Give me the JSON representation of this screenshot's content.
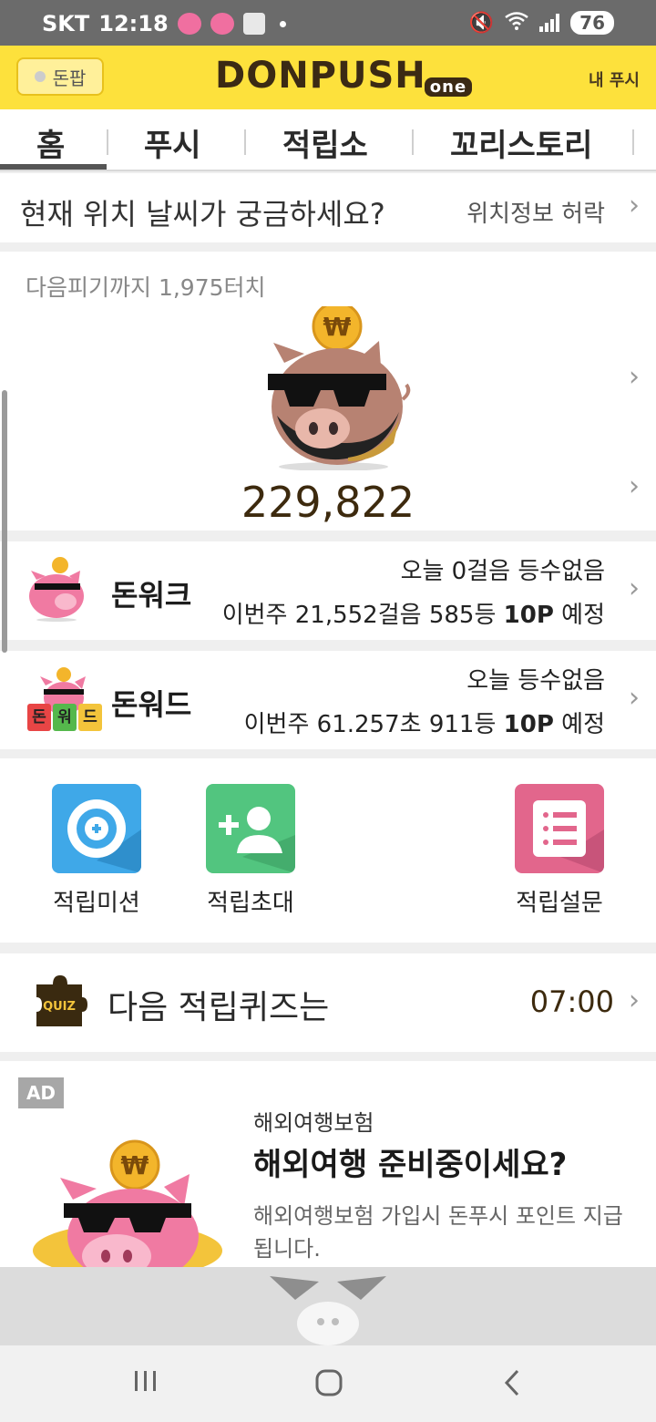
{
  "status": {
    "carrier": "SKT",
    "time": "12:18",
    "battery": "76"
  },
  "appbar": {
    "donpan_label": "돈팝",
    "logo": "DONPUSH",
    "logo_suffix": "one",
    "my_push": "내 푸시"
  },
  "tabs": [
    {
      "label": "홈"
    },
    {
      "label": "푸시"
    },
    {
      "label": "적립소"
    },
    {
      "label": "꼬리스토리"
    }
  ],
  "location": {
    "question": "현재 위치 날씨가 궁금하세요?",
    "permission": "위치정보 허락"
  },
  "pig": {
    "next_text": "다음피기까지 1,975터치",
    "total": "229,822"
  },
  "donwalk": {
    "title": "돈워크",
    "line1": "오늘 0걸음 등수없음",
    "line2_prefix": "이번주 21,552걸음 585등 ",
    "line2_bold": "10P",
    "line2_suffix": " 예정"
  },
  "donword": {
    "title": "돈워드",
    "tiles": [
      "돈",
      "워",
      "드"
    ],
    "line1": "오늘 등수없음",
    "line2_prefix": "이번주 61.257초 911등 ",
    "line2_bold": "10P",
    "line2_suffix": " 예정"
  },
  "actions": [
    {
      "label": "적립미션",
      "color": "#3fa8e8"
    },
    {
      "label": "적립초대",
      "color": "#52c57f"
    },
    {
      "label": "적립설문",
      "color": "#e2668c"
    }
  ],
  "quiz": {
    "icon_text": "QUIZ",
    "text": "다음 적립퀴즈는",
    "time": "07:00"
  },
  "ad": {
    "badge": "AD",
    "category": "해외여행보험",
    "headline": "해외여행 준비중이세요?",
    "body": "해외여행보험 가입시 돈푸시 포인트 지급됩니다."
  },
  "colors": {
    "brand_yellow": "#fde13c",
    "brown": "#3d2a0e"
  }
}
